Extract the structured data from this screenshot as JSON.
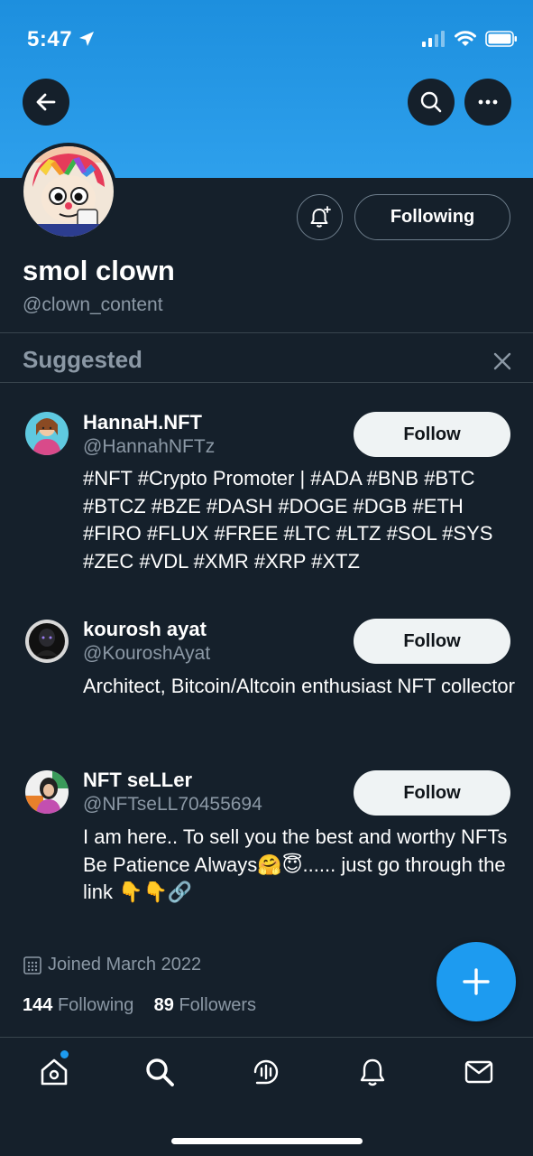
{
  "status_bar": {
    "time": "5:47"
  },
  "profile": {
    "display_name": "smol clown",
    "handle": "@clown_content",
    "following_button": "Following",
    "joined": "Joined March 2022",
    "following_count": "144",
    "following_label": "Following",
    "followers_count": "89",
    "followers_label": "Followers"
  },
  "suggested": {
    "title": "Suggested",
    "follow_label": "Follow",
    "items": [
      {
        "name": "HannaH.NFT",
        "handle": "@HannahNFTz",
        "bio": "#NFT #Crypto Promoter | #ADA #BNB #BTC #BTCZ #BZE #DASH #DOGE #DGB #ETH #FIRO #FLUX #FREE #LTC #LTZ #SOL #SYS #ZEC #VDL #XMR #XRP #XTZ"
      },
      {
        "name": "kourosh ayat",
        "handle": "@KouroshAyat",
        "bio": "Architect, Bitcoin/Altcoin enthusiast NFT collector"
      },
      {
        "name": "NFT seLLer",
        "handle": "@NFTseLL70455694",
        "bio": "I am here.. To sell you the best and worthy NFTs Be Patience Always🤗😇...... just go through the link 👇👇🔗"
      }
    ]
  },
  "colors": {
    "background": "#15202b",
    "banner": "#1d8fde",
    "accent": "#1d9bf0",
    "muted_text": "#8b98a5",
    "follow_button_bg": "#eff3f4"
  },
  "icons": {
    "back": "arrow-left-icon",
    "search": "search-icon",
    "more": "more-icon",
    "notify": "bell-plus-icon",
    "close": "close-icon",
    "calendar": "calendar-icon",
    "compose": "plus-icon",
    "nav_home": "home-icon",
    "nav_search": "search-icon",
    "nav_spaces": "spaces-icon",
    "nav_notifications": "bell-icon",
    "nav_messages": "mail-icon"
  }
}
